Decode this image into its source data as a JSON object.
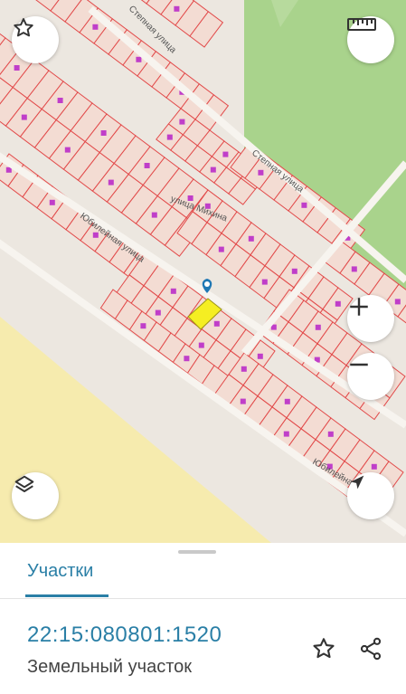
{
  "map": {
    "streets": {
      "stepnaya_upper": "Степная улица",
      "stepnaya_lower": "Степная улица",
      "mikhina": "улица Михина",
      "yubileynaya_upper": "Юбилейная улица",
      "yubileynaya_lower": "Юбилейна"
    },
    "colors": {
      "parcel_outline": "#e24a4a",
      "parcel_fill": "#f3dcd3",
      "building": "#c03ec9",
      "selected_parcel": "#f5ee22",
      "marker": "#1f78b4",
      "forest": "#a9d38c",
      "field": "#f6ebae"
    },
    "controls": {
      "favorite": "star-icon",
      "ruler": "ruler-icon",
      "zoom_in": "plus-icon",
      "zoom_out": "minus-icon",
      "layers": "layers-icon",
      "locate": "navigation-arrow-icon"
    }
  },
  "panel": {
    "tab_label": "Участки",
    "cadastral_number": "22:15:080801:1520",
    "property_type": "Земельный участок",
    "actions": {
      "favorite": "star-outline-icon",
      "share": "share-icon"
    }
  }
}
